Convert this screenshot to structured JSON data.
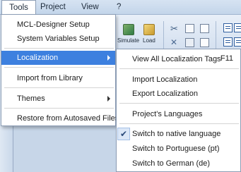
{
  "menubar": {
    "items": [
      "Tools",
      "Project",
      "View",
      "?"
    ]
  },
  "ribbon": {
    "simulate_label": "Simulate",
    "load_label": "Load"
  },
  "tools_menu": {
    "items": [
      "MCL-Designer Setup",
      "System Variables Setup",
      "Localization",
      "Import from Library",
      "Themes",
      "Restore from Autosaved Files"
    ]
  },
  "localization_menu": {
    "view_all": "View All Localization Tags",
    "view_all_shortcut": "F11",
    "import": "Import Localization",
    "export": "Export Localization",
    "project_languages": "Project's Languages",
    "native": "Switch to native language",
    "native_check": "✔",
    "portuguese": "Switch to Portuguese  (pt)",
    "german": "Switch to German  (de)"
  },
  "colors": {
    "highlight": "#3d80df",
    "menubar": "#c3d5ea",
    "workarea": "#c7d6e8"
  }
}
